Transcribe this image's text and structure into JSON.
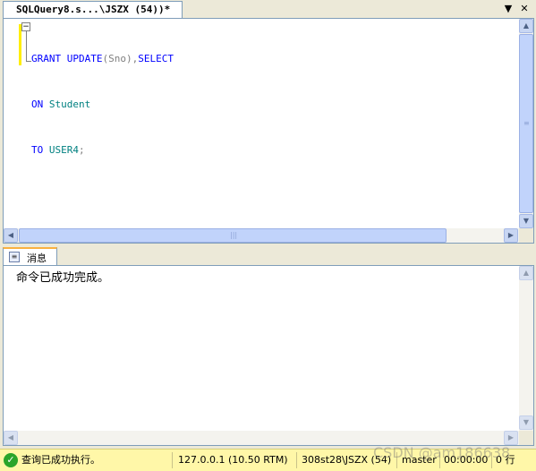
{
  "document_tab": {
    "title": "SQLQuery8.s...\\JSZX (54))*",
    "dropdown_icon": "triangle-down",
    "close_icon": "x"
  },
  "editor": {
    "lines": [
      {
        "kw1": "GRANT",
        "kw2": "UPDATE",
        "paren": "(Sno)",
        "comma": ",",
        "kw3": "SELECT"
      },
      {
        "kw": "ON",
        "obj": "Student"
      },
      {
        "kw": "TO",
        "obj": "USER4",
        "end": ";"
      }
    ]
  },
  "results_tab": {
    "label": "消息",
    "icon": "messages-icon"
  },
  "results": {
    "message": "命令已成功完成。"
  },
  "statusbar": {
    "status": "查询已成功执行。",
    "server": "127.0.0.1 (10.50 RTM)",
    "login": "308st28\\JSZX (54)",
    "database": "master",
    "time": "00:00:00",
    "rows": "0 行"
  },
  "watermark": "CSDN @am186638",
  "colors": {
    "keyword": "#0000ff",
    "identifier": "#008080",
    "statusbar": "#fff7a8",
    "tab_accent": "#f9b140"
  }
}
